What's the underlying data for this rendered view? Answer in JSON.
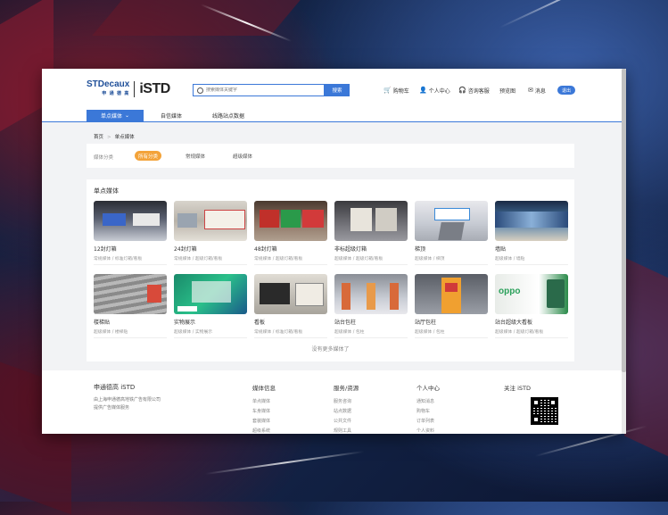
{
  "header": {
    "logo_brand": "STDecaux",
    "logo_sub": "申 通 德 高",
    "logo_istd": "iSTD",
    "search_placeholder": "搜索媒体关键字",
    "search_button": "搜索",
    "nav": [
      {
        "icon": "cart-icon",
        "glyph": "🛒",
        "label": "购物车"
      },
      {
        "icon": "user-icon",
        "glyph": "👤",
        "label": "个人中心"
      },
      {
        "icon": "headset-icon",
        "glyph": "🎧",
        "label": "咨询客服"
      },
      {
        "icon": "",
        "glyph": "",
        "label": "预览图"
      },
      {
        "icon": "mail-icon",
        "glyph": "✉",
        "label": "消息"
      }
    ],
    "logout": "退出"
  },
  "subnav": {
    "items": [
      "单点媒体",
      "自信媒体",
      "线路站点数据"
    ],
    "active_index": 0
  },
  "breadcrumb": {
    "home": "首页",
    "current": "单点媒体"
  },
  "filter": {
    "label": "媒体分类",
    "chips": [
      "所有分类",
      "常规媒体",
      "超级媒体"
    ],
    "active_index": 0
  },
  "main": {
    "title": "单点媒体",
    "no_more": "没有更多媒体了",
    "cards": [
      {
        "name": "12封灯箱",
        "tags": "常规媒体 / 标准灯箱/看板",
        "thumb": "thumb-12-lightbox"
      },
      {
        "name": "24封灯箱",
        "tags": "常规媒体 / 超级灯箱/看板",
        "thumb": "thumb-24-lightbox"
      },
      {
        "name": "48封灯箱",
        "tags": "常规媒体 / 超级灯箱/看板",
        "thumb": "thumb-48-lightbox"
      },
      {
        "name": "非标超级灯箱",
        "tags": "超级媒体 / 超级灯箱/看板",
        "thumb": "thumb-nonstandard"
      },
      {
        "name": "梯顶",
        "tags": "超级媒体 / 梯顶",
        "thumb": "thumb-escalator-top"
      },
      {
        "name": "墙贴",
        "tags": "超级媒体 / 墙贴",
        "thumb": "thumb-wall-sticker"
      },
      {
        "name": "楼梯贴",
        "tags": "超级媒体 / 楼梯贴",
        "thumb": "thumb-stair-sticker"
      },
      {
        "name": "实物展示",
        "tags": "超级媒体 / 实物展示",
        "thumb": "thumb-display"
      },
      {
        "name": "看板",
        "tags": "常规媒体 / 标准灯箱/看板",
        "thumb": "thumb-board"
      },
      {
        "name": "站台包柱",
        "tags": "超级媒体 / 包柱",
        "thumb": "thumb-platform-pillar"
      },
      {
        "name": "站厅包柱",
        "tags": "超级媒体 / 包柱",
        "thumb": "thumb-hall-pillar"
      },
      {
        "name": "站台超级大看板",
        "tags": "超级媒体 / 超级灯箱/看板",
        "thumb": "thumb-super-board"
      }
    ]
  },
  "footer": {
    "brand": "申通德高 iSTD",
    "company_line1": "由上海申通德高地铁广告有限公司",
    "company_line2": "提供广告媒体服务",
    "columns": [
      {
        "title": "媒体信息",
        "links": [
          "单点媒体",
          "车身媒体",
          "套装媒体",
          "超级系统"
        ]
      },
      {
        "title": "服务/资源",
        "links": [
          "服务咨询",
          "站点数据",
          "公共文件",
          "规则工具"
        ]
      },
      {
        "title": "个人中心",
        "links": [
          "通知消息",
          "购物车",
          "订单列表",
          "个人资料"
        ]
      },
      {
        "title": "关注 iSTD",
        "links": []
      }
    ]
  },
  "colors": {
    "accent": "#3b78d8",
    "chip_active": "#f3a33a"
  }
}
